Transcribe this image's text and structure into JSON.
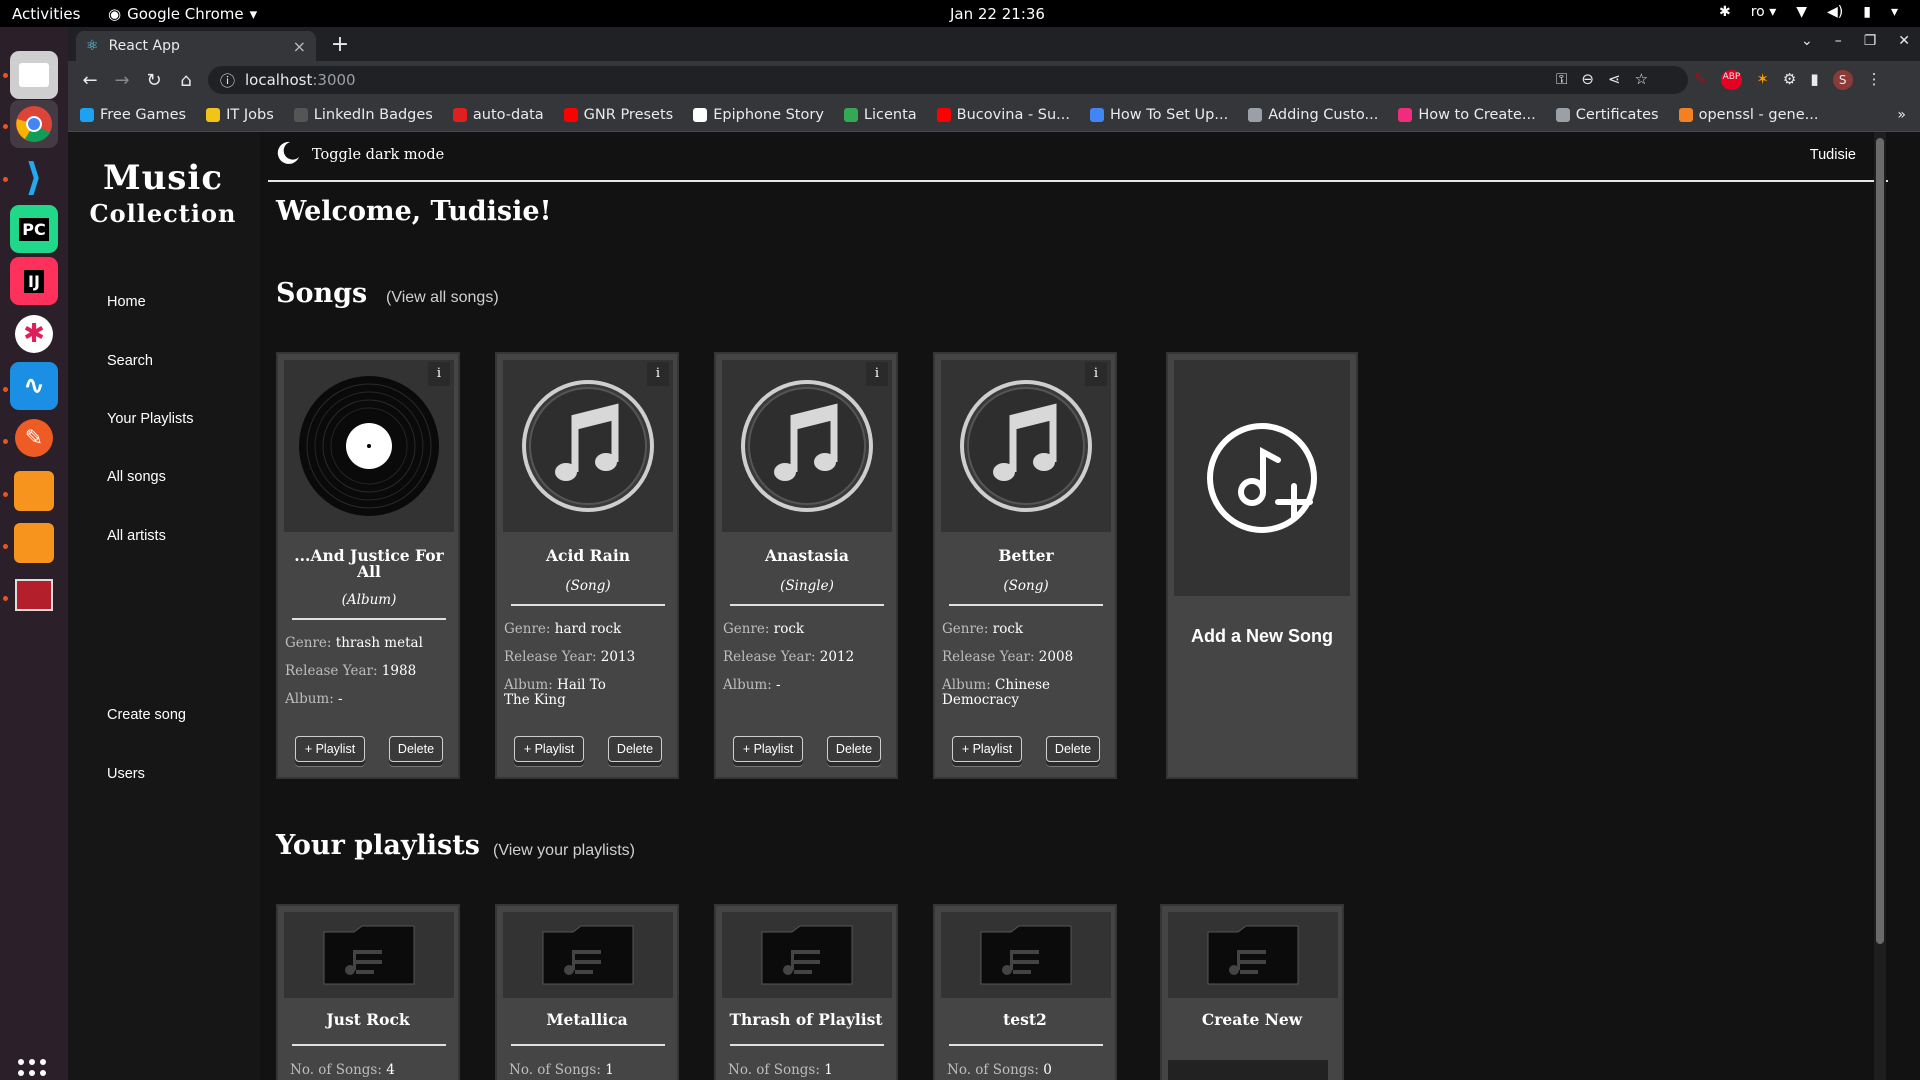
{
  "system": {
    "activities": "Activities",
    "app_name": "Google Chrome",
    "clock": "Jan 22  21:36",
    "lang": "ro"
  },
  "browser": {
    "tab_title": "React App",
    "url_host": "localhost",
    "url_port": ":3000",
    "bookmarks": [
      {
        "label": "Free Games",
        "color": "#1da1f2"
      },
      {
        "label": "IT Jobs",
        "color": "#f0c419"
      },
      {
        "label": "LinkedIn Badges",
        "color": "#555555"
      },
      {
        "label": "auto-data",
        "color": "#e02020"
      },
      {
        "label": "GNR Presets",
        "color": "#ff0000"
      },
      {
        "label": "Epiphone Story",
        "color": "#ffffff"
      },
      {
        "label": "Licenta",
        "color": "#34a853"
      },
      {
        "label": "Bucovina - Su...",
        "color": "#ff0000"
      },
      {
        "label": "How To Set Up...",
        "color": "#4285f4"
      },
      {
        "label": "Adding Custo...",
        "color": "#9aa0a6"
      },
      {
        "label": "How to Create...",
        "color": "#f02d7d"
      },
      {
        "label": "Certificates",
        "color": "#9aa0a6"
      },
      {
        "label": "openssl - gene...",
        "color": "#f48024"
      }
    ]
  },
  "app": {
    "logo_line1": "Music",
    "logo_line2": "Collection",
    "nav": {
      "home": "Home",
      "search": "Search",
      "playlists": "Your Playlists",
      "all_songs": "All songs",
      "all_artists": "All artists",
      "create_song": "Create song",
      "users": "Users"
    },
    "header": {
      "toggle_label": "Toggle dark mode",
      "username": "Tudisie"
    },
    "welcome": "Welcome, Tudisie!",
    "songs_section": {
      "title": "Songs",
      "link": "(View all songs)"
    },
    "songs": [
      {
        "title": "...And Justice For All",
        "type": "(Album)",
        "genre": "thrash metal",
        "year": "1988",
        "album": "-",
        "image": "vinyl-record"
      },
      {
        "title": "Acid Rain",
        "type": "(Song)",
        "genre": "hard rock",
        "year": "2013",
        "album": "Hail To The King",
        "image": "music-note"
      },
      {
        "title": "Anastasia",
        "type": "(Single)",
        "genre": "rock",
        "year": "2012",
        "album": "-",
        "image": "music-note"
      },
      {
        "title": "Better",
        "type": "(Song)",
        "genre": "rock",
        "year": "2008",
        "album": "Chinese Democracy",
        "image": "music-note"
      }
    ],
    "labels": {
      "genre": "Genre: ",
      "year": "Release Year: ",
      "album": "Album: ",
      "info": "i",
      "add_playlist": "+ Playlist",
      "delete": "Delete",
      "num_songs": "No. of Songs: "
    },
    "add_song_label": "Add a New Song",
    "playlists_section": {
      "title": "Your playlists",
      "link": "(View your playlists)"
    },
    "playlists": [
      {
        "title": "Just Rock",
        "count": "4"
      },
      {
        "title": "Metallica",
        "count": "1"
      },
      {
        "title": "Thrash of Playlist",
        "count": "1"
      },
      {
        "title": "test2",
        "count": "0"
      }
    ],
    "create_playlist_label": "Create New"
  }
}
